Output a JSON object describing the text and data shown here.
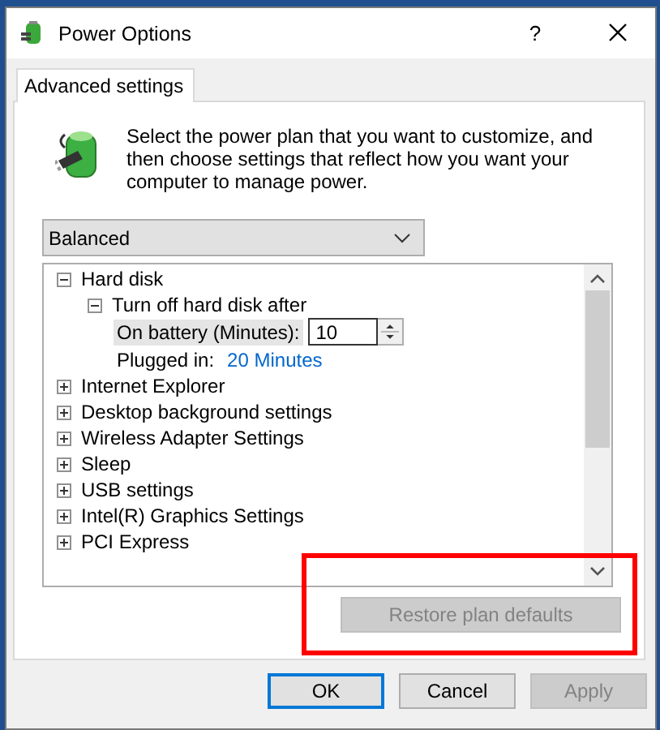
{
  "window": {
    "title": "Power Options",
    "help": "?"
  },
  "tabs": [
    {
      "label": "Advanced settings",
      "selected": true
    }
  ],
  "description": "Select the power plan that you want to customize, and then choose settings that reflect how you want your computer to manage power.",
  "plan_dropdown": {
    "value": "Balanced"
  },
  "tree": [
    {
      "label": "Hard disk",
      "expanded": true,
      "children": [
        {
          "label": "Turn off hard disk after",
          "expanded": true,
          "settings": [
            {
              "kind": "spin",
              "label": "On battery (Minutes):",
              "value": "10",
              "selected": true
            },
            {
              "kind": "link",
              "label": "Plugged in:",
              "value": "20 Minutes",
              "selected": false
            }
          ]
        }
      ]
    },
    {
      "label": "Internet Explorer",
      "expanded": false
    },
    {
      "label": "Desktop background settings",
      "expanded": false
    },
    {
      "label": "Wireless Adapter Settings",
      "expanded": false
    },
    {
      "label": "Sleep",
      "expanded": false
    },
    {
      "label": "USB settings",
      "expanded": false
    },
    {
      "label": "Intel(R) Graphics Settings",
      "expanded": false
    },
    {
      "label": "PCI Express",
      "expanded": false
    }
  ],
  "restore_button": {
    "label": "Restore plan defaults",
    "disabled": true
  },
  "buttons": [
    {
      "label": "OK",
      "focused": true,
      "disabled": false
    },
    {
      "label": "Cancel",
      "focused": false,
      "disabled": false
    },
    {
      "label": "Apply",
      "focused": false,
      "disabled": true
    }
  ]
}
